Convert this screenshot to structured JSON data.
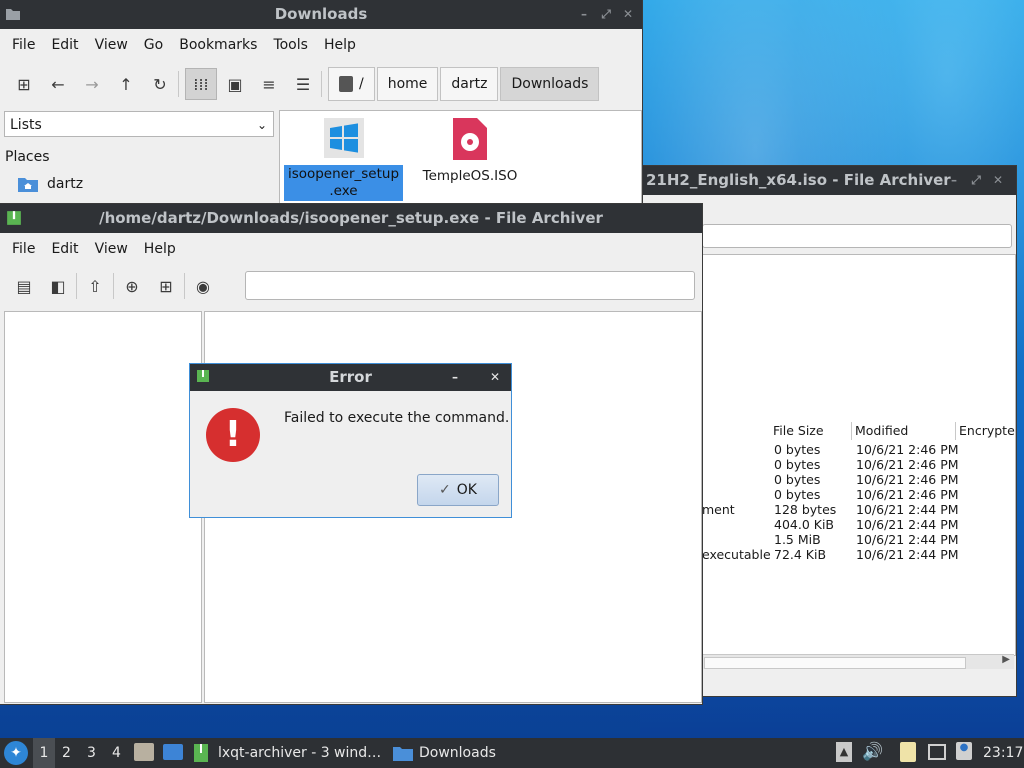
{
  "fm": {
    "title": "Downloads",
    "menu": [
      "File",
      "Edit",
      "View",
      "Go",
      "Bookmarks",
      "Tools",
      "Help"
    ],
    "crumbs": [
      "/",
      "home",
      "dartz",
      "Downloads"
    ],
    "side_select": "Lists",
    "places_label": "Places",
    "place_item": "dartz",
    "files": [
      {
        "name_line1": "isoopener_setup",
        "name_line2": ".exe"
      },
      {
        "name_line1": "TempleOS.ISO"
      }
    ]
  },
  "ar_back": {
    "title": "21H2_English_x64.iso - File Archiver",
    "columns": [
      "File Size",
      "Modified",
      "Encrypte"
    ],
    "rows": [
      {
        "type": "",
        "size": "0 bytes",
        "modified": "10/6/21 2:46 PM"
      },
      {
        "type": "",
        "size": "0 bytes",
        "modified": "10/6/21 2:46 PM"
      },
      {
        "type": "",
        "size": "0 bytes",
        "modified": "10/6/21 2:46 PM"
      },
      {
        "type": "",
        "size": "0 bytes",
        "modified": "10/6/21 2:46 PM"
      },
      {
        "type": "ment",
        "size": "128 bytes",
        "modified": "10/6/21 2:44 PM"
      },
      {
        "type": "",
        "size": "404.0 KiB",
        "modified": "10/6/21 2:44 PM"
      },
      {
        "type": "",
        "size": "1.5 MiB",
        "modified": "10/6/21 2:44 PM"
      },
      {
        "type": "executable",
        "size": "72.4 KiB",
        "modified": "10/6/21 2:44 PM"
      }
    ]
  },
  "ar_front": {
    "title": "/home/dartz/Downloads/isoopener_setup.exe - File Archiver",
    "menu": [
      "File",
      "Edit",
      "View",
      "Help"
    ]
  },
  "error": {
    "title": "Error",
    "message": "Failed to execute the command.",
    "ok": "OK"
  },
  "taskbar": {
    "desktops": [
      "1",
      "2",
      "3",
      "4"
    ],
    "task1": "lxqt-archiver - 3 wind…",
    "task2": "Downloads",
    "clock": "23:17"
  }
}
